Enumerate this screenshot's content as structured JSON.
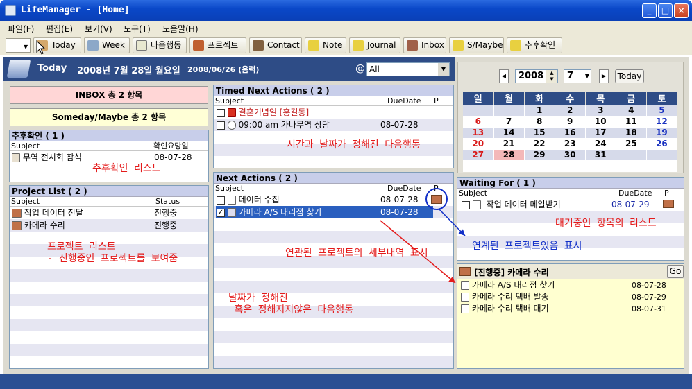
{
  "window": {
    "title": "LifeManager - [Home]"
  },
  "menu": [
    "파일(F)",
    "편집(E)",
    "보기(V)",
    "도구(T)",
    "도움말(H)"
  ],
  "toolbar": {
    "today": "Today",
    "week": "Week",
    "next": "다음행동",
    "project": "프로젝트",
    "contact": "Contact",
    "note": "Note",
    "journal": "Journal",
    "inbox": "Inbox",
    "smaybe": "S/Maybe",
    "followup": "추후확인"
  },
  "datebar": {
    "today": "Today",
    "date": "2008년 7월 28일 월요일",
    "lunar": "2008/06/26 (음력)",
    "at": "@",
    "filter": "All"
  },
  "left": {
    "inbox": "INBOX 총 2 항목",
    "someday": "Someday/Maybe 총 2 항목",
    "followup": {
      "header": "추후확인 ( 1 )",
      "col_subject": "Subject",
      "col_date": "확인요망일",
      "rows": [
        {
          "subject": "무역 전시회 참석",
          "date": "08-07-28"
        }
      ]
    },
    "projects": {
      "header": "Project List ( 2 )",
      "col_subject": "Subject",
      "col_status": "Status",
      "rows": [
        {
          "subject": "작업 데이터 전달",
          "status": "진행중"
        },
        {
          "subject": "카메라 수리",
          "status": "진행중"
        }
      ]
    }
  },
  "timed": {
    "header": "Timed Next Actions ( 2 )",
    "col_subject": "Subject",
    "col_due": "DueDate",
    "col_p": "P",
    "rows": [
      {
        "subject": "결혼기념일 [홍길동]",
        "due": ""
      },
      {
        "subject": "09:00 am 가나무역 상담",
        "due": "08-07-28"
      }
    ]
  },
  "next": {
    "header": "Next Actions ( 2 )",
    "col_subject": "Subject",
    "col_due": "DueDate",
    "col_p": "P",
    "rows": [
      {
        "subject": "데이터 수집",
        "due": "08-07-28"
      },
      {
        "subject": "카메라 A/S 대리점 찾기",
        "due": "08-07-28"
      }
    ]
  },
  "calendar": {
    "year": "2008",
    "month": "7",
    "today_btn": "Today",
    "weekdays": [
      "일",
      "월",
      "화",
      "수",
      "목",
      "금",
      "토"
    ],
    "weeks": [
      [
        "",
        "",
        "1",
        "2",
        "3",
        "4",
        "5"
      ],
      [
        "6",
        "7",
        "8",
        "9",
        "10",
        "11",
        "12"
      ],
      [
        "13",
        "14",
        "15",
        "16",
        "17",
        "18",
        "19"
      ],
      [
        "20",
        "21",
        "22",
        "23",
        "24",
        "25",
        "26"
      ],
      [
        "27",
        "28",
        "29",
        "30",
        "31",
        "",
        ""
      ],
      [
        "",
        "",
        "",
        "",
        "",
        "",
        ""
      ]
    ],
    "selected": "28"
  },
  "waiting": {
    "header": "Waiting For ( 1 )",
    "col_subject": "Subject",
    "col_due": "DueDate",
    "col_p": "P",
    "rows": [
      {
        "subject": "작업 데이터 메일받기",
        "due": "08-07-29"
      }
    ]
  },
  "project_detail": {
    "title": "[진행중] 카메라 수리",
    "go": "Go",
    "rows": [
      {
        "subject": "카메라 A/S 대리점 찾기",
        "date": "08-07-28"
      },
      {
        "subject": "카메라 수리 택배 발송",
        "date": "08-07-29"
      },
      {
        "subject": "카메라 수리 택배 대기",
        "date": "08-07-31"
      }
    ]
  },
  "annotations": {
    "followup": "추후확인 리스트",
    "projects1": "프로젝트 리스트",
    "projects2": "- 진행중인 프로젝트를 보여줌",
    "timed": "시간과 날짜가 정해진 다음행동",
    "related": "연관된 프로젝트의 세부내역 표시",
    "linked": "연계된 프로젝트있음 표시",
    "waiting": "대기중인 항목의 리스트",
    "next1": "날짜가 정해진",
    "next2": " 혹은 정해지지않은 다음행동"
  }
}
